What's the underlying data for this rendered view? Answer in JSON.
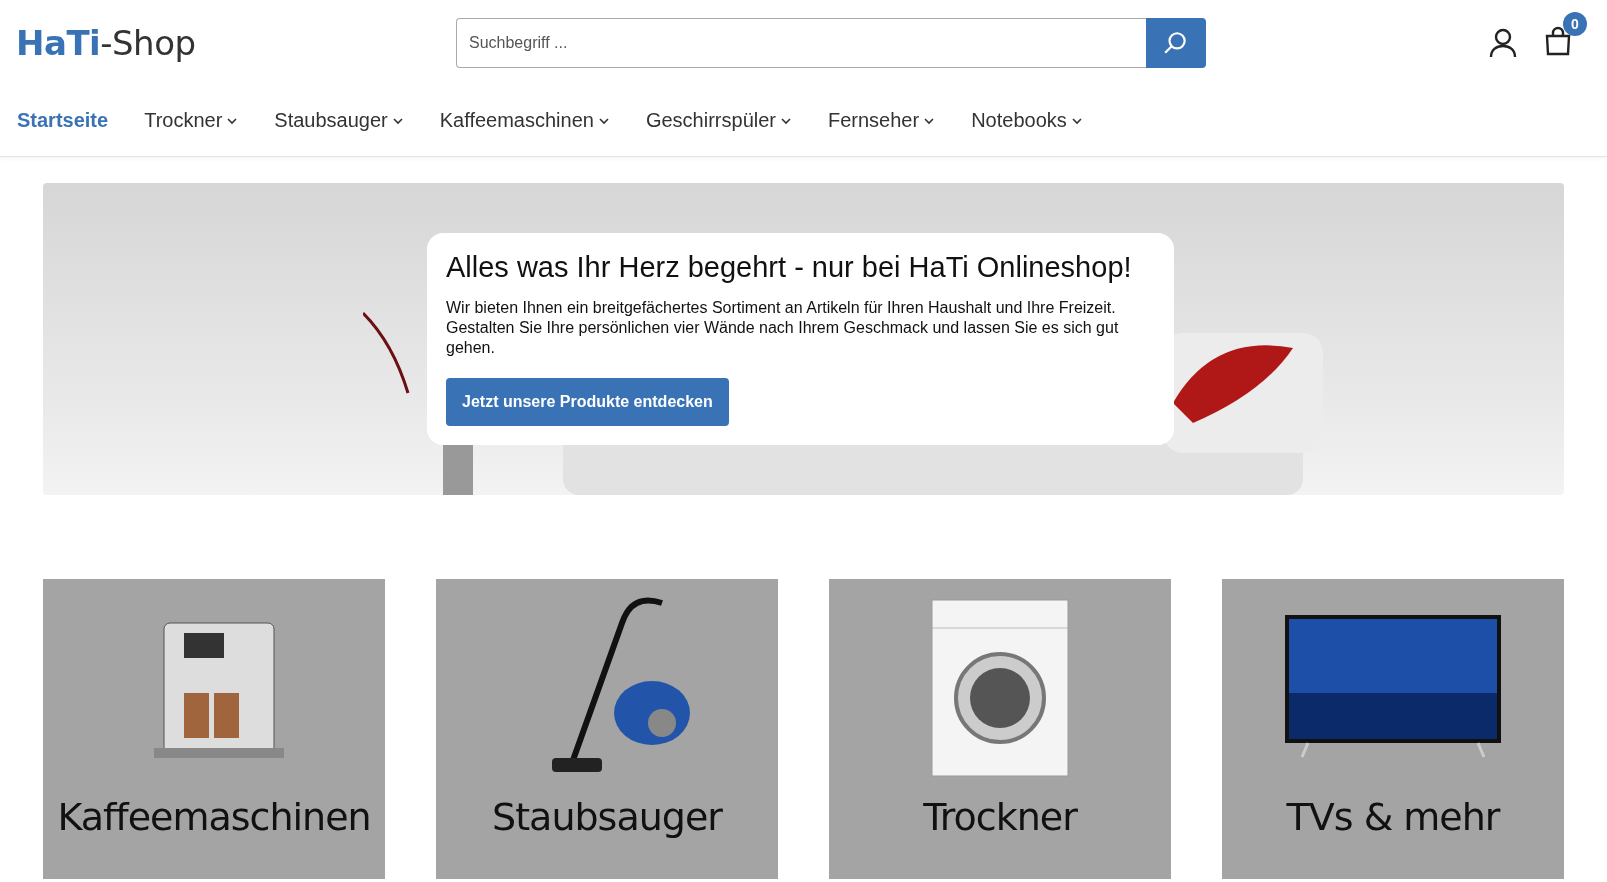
{
  "header": {
    "logo": "**HaTi**-Shop",
    "search": {
      "placeholder": "Suchbegriff ..."
    },
    "cart": {
      "count": "0"
    }
  },
  "nav": [
    {
      "label": "Startseite",
      "selected": true,
      "has_menu": false
    },
    {
      "label": "Trockner",
      "selected": false,
      "has_menu": true
    },
    {
      "label": "Staubsauger",
      "selected": false,
      "has_menu": true
    },
    {
      "label": "Kaffeemaschinen",
      "selected": false,
      "has_menu": true
    },
    {
      "label": "Geschirrspüler",
      "selected": false,
      "has_menu": true
    },
    {
      "label": "Fernseher",
      "selected": false,
      "has_menu": true
    },
    {
      "label": "Notebooks",
      "selected": false,
      "has_menu": true
    }
  ],
  "hero": {
    "title": "Alles was Ihr Herz begehrt - nur bei HaTi Onlineshop!",
    "text": "Wir bieten Ihnen ein breitgefächertes Sortiment an Artikeln für Ihren Haushalt und Ihre Freizeit. Gestalten Sie Ihre persönlichen vier Wände nach Ihrem Geschmack und lassen Sie es sich gut gehen.",
    "button": "Jetzt unsere Produkte entdecken"
  },
  "categories": [
    {
      "label": "Kaffeemaschinen",
      "kind": "coffee"
    },
    {
      "label": "Staubsauger",
      "kind": "vacuum"
    },
    {
      "label": "Trockner",
      "kind": "washer"
    },
    {
      "label": "TVs & mehr",
      "kind": "tv"
    }
  ]
}
